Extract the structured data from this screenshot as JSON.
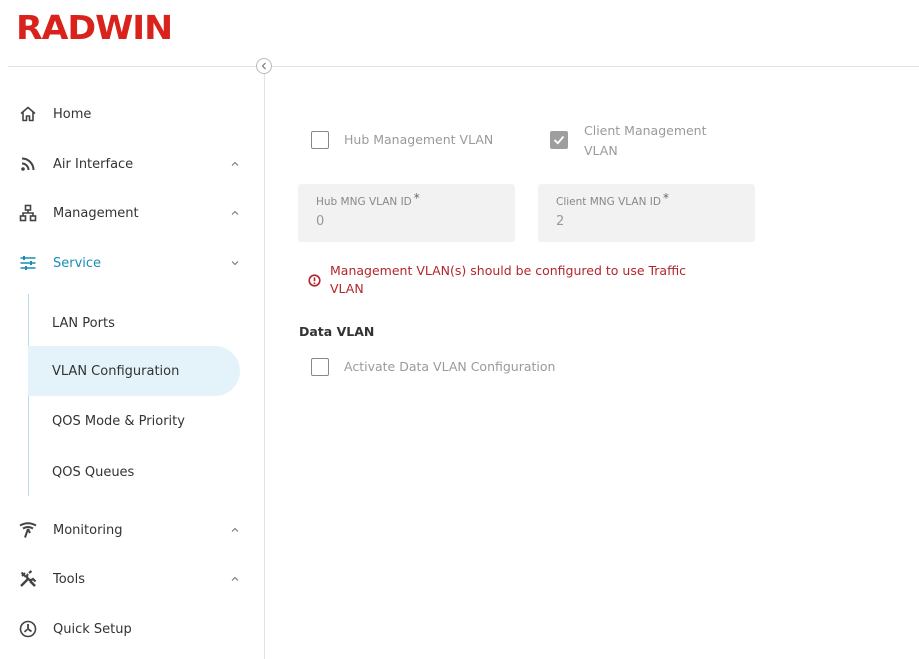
{
  "brand": {
    "name": "RADWIN",
    "color": "#d9221c"
  },
  "sidebar": {
    "collapse_icon": "chevron-left-icon",
    "items": [
      {
        "label": "Home",
        "icon": "home-icon"
      },
      {
        "label": "Air Interface",
        "icon": "air-signal-icon",
        "chevron": "up"
      },
      {
        "label": "Management",
        "icon": "network-icon",
        "chevron": "up"
      },
      {
        "label": "Service",
        "icon": "sliders-icon",
        "chevron": "down",
        "active": true
      },
      {
        "label": "Monitoring",
        "icon": "antenna-icon",
        "chevron": "up"
      },
      {
        "label": "Tools",
        "icon": "tools-icon",
        "chevron": "up"
      },
      {
        "label": "Quick Setup",
        "icon": "quick-setup-icon"
      }
    ],
    "service_sub": [
      {
        "label": "LAN Ports"
      },
      {
        "label": "VLAN Configuration",
        "selected": true
      },
      {
        "label": "QOS Mode & Priority"
      },
      {
        "label": "QOS Queues"
      }
    ]
  },
  "main": {
    "hub_mgmt_vlan": {
      "label": "Hub Management VLAN",
      "checked": false
    },
    "client_mgmt_vlan": {
      "label_line1": "Client Management",
      "label_line2": "VLAN",
      "checked": true
    },
    "hub_vlan_id": {
      "label": "Hub MNG VLAN ID",
      "required": "*",
      "value": "0"
    },
    "client_vlan_id": {
      "label": "Client MNG VLAN ID",
      "required": "*",
      "value": "2"
    },
    "error": {
      "line1": "Management VLAN(s) should be configured to use Traffic",
      "line2": "VLAN",
      "color": "#b3262b"
    },
    "data_vlan": {
      "title": "Data VLAN",
      "activate": {
        "label": "Activate Data VLAN Configuration",
        "checked": false
      }
    }
  },
  "colors": {
    "accent": "#1a8bb5",
    "selected_bg": "#e3f3f9"
  }
}
